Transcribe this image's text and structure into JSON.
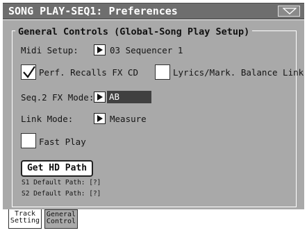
{
  "window": {
    "title": "SONG PLAY-SEQ1: Preferences",
    "menu_icon": "triangle-down-icon"
  },
  "group": {
    "title": "General Controls (Global-Song Play Setup)"
  },
  "midi_setup": {
    "label": "Midi Setup:",
    "value": "03 Sequencer 1"
  },
  "perf_recalls_fx": {
    "label": "Perf. Recalls FX CD",
    "checked": true
  },
  "lyrics_balance": {
    "label": "Lyrics/Mark. Balance Link",
    "checked": false
  },
  "seq2_fx_mode": {
    "label": "Seq.2 FX Mode:",
    "value": "AB"
  },
  "link_mode": {
    "label": "Link Mode:",
    "value": "Measure"
  },
  "fast_play": {
    "label": "Fast Play",
    "checked": false
  },
  "get_hd_path": {
    "label": "Get HD Path"
  },
  "paths": {
    "s1": "S1 Default Path: [?]",
    "s2": "S2 Default Path: [?]"
  },
  "tabs": [
    {
      "line1": "Track",
      "line2": "Setting",
      "active": true
    },
    {
      "line1": "General",
      "line2": "Control",
      "active": false
    }
  ],
  "colors": {
    "titlebar": "#6e6e6e",
    "panel": "#a9a9a9",
    "value_highlight": "#404040"
  }
}
